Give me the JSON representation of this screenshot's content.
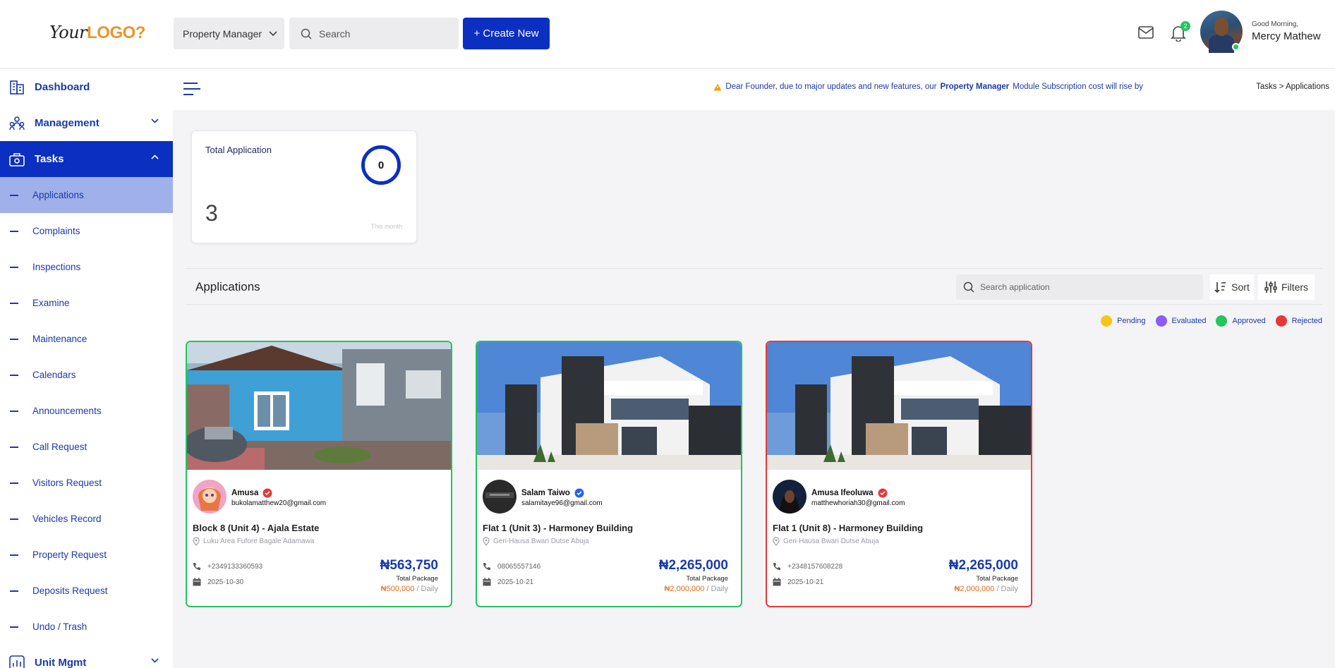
{
  "header": {
    "logo_text": "Your",
    "logo_mark": "LOGO?",
    "role_select": "Property Manager",
    "search_placeholder": "Search",
    "create_button": "+ Create New",
    "notification_count": "2",
    "greeting": "Good Morning,",
    "user_name": "Mercy Mathew"
  },
  "sidebar": {
    "main": [
      {
        "label": "Dashboard",
        "icon": "building-icon"
      },
      {
        "label": "Management",
        "icon": "users-icon"
      },
      {
        "label": "Tasks",
        "icon": "briefcase-icon"
      }
    ],
    "tasks_items": [
      "Applications",
      "Complaints",
      "Inspections",
      "Examine",
      "Maintenance",
      "Calendars",
      "Announcements",
      "Call Request",
      "Visitors Request",
      "Vehicles Record",
      "Property Request",
      "Deposits Request",
      "Undo / Trash"
    ],
    "unit_mgmt": "Unit Mgmt"
  },
  "topbar": {
    "notice_prefix": "Dear Founder, due to major updates and new features, our",
    "notice_bold": "Property Manager",
    "notice_suffix": "Module Subscription cost will rise by",
    "breadcrumb": "Tasks > Applications"
  },
  "stats": {
    "title": "Total Application",
    "ring_value": "0",
    "value": "3",
    "period": "This month"
  },
  "applications": {
    "title": "Applications",
    "search_placeholder": "Search application",
    "sort_label": "Sort",
    "filter_label": "Filters",
    "legend": [
      {
        "label": "Pending",
        "color": "#f5c518"
      },
      {
        "label": "Evaluated",
        "color": "#8b5cf6"
      },
      {
        "label": "Approved",
        "color": "#22c55e"
      },
      {
        "label": "Rejected",
        "color": "#e53935"
      }
    ],
    "cards": [
      {
        "status": "Approved",
        "name": "Amusa",
        "verified_color": "#e53935",
        "email": "bukolamatthew20@gmail.com",
        "title": "Block 8 (Unit 4) - Ajala Estate",
        "location": "Luku Area Fufore Bagale Adamawa",
        "phone": "+2349133360593",
        "date": "2025-10-30",
        "price": "₦563,750",
        "package_label": "Total Package",
        "rate": "₦500,000",
        "rate_period": "/ Daily"
      },
      {
        "status": "Approved",
        "name": "Salam Taiwo",
        "verified_color": "#2563eb",
        "email": "salamitaye96@gmail.com",
        "title": "Flat 1 (Unit 3) - Harmoney Building",
        "location": "Geri-Hausa Bwari Dutse Abuja",
        "phone": "08065557146",
        "date": "2025-10-21",
        "price": "₦2,265,000",
        "package_label": "Total Package",
        "rate": "₦2,000,000",
        "rate_period": "/ Daily"
      },
      {
        "status": "Rejected",
        "name": "Amusa Ifeoluwa",
        "verified_color": "#e53935",
        "email": "matthewhoriah30@gmail.com",
        "title": "Flat 1 (Unit 8) - Harmoney Building",
        "location": "Geri-Hausa Bwari Dutse Abuja",
        "phone": "+2348157608228",
        "date": "2025-10-21",
        "price": "₦2,265,000",
        "package_label": "Total Package",
        "rate": "₦2,000,000",
        "rate_period": "/ Daily"
      }
    ]
  }
}
